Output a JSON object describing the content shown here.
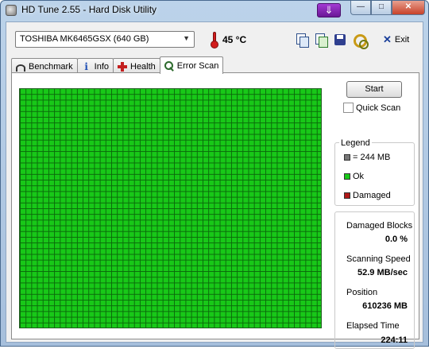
{
  "window": {
    "title": "HD Tune 2.55 - Hard Disk Utility",
    "download_badge": "⇓",
    "controls": {
      "minimize": "—",
      "maximize": "□",
      "close": "✕"
    }
  },
  "toolbar": {
    "drive": "TOSHIBA MK6465GSX (640 GB)",
    "temperature": "45 °C",
    "icons": [
      "copy-text-icon",
      "copy-screenshot-icon",
      "save-icon",
      "options-icon"
    ],
    "exit_label": "Exit"
  },
  "tabs": [
    {
      "label": "Benchmark",
      "icon": "benchmark-icon",
      "active": false
    },
    {
      "label": "Info",
      "icon": "info-icon",
      "active": false
    },
    {
      "label": "Health",
      "icon": "health-icon",
      "active": false
    },
    {
      "label": "Error Scan",
      "icon": "search-icon",
      "active": true
    }
  ],
  "scan": {
    "start_label": "Start",
    "quick_scan_label": "Quick Scan",
    "quick_scan_checked": false,
    "grid_status": "all blocks ok",
    "grid_color": "#18c818"
  },
  "legend": {
    "title": "Legend",
    "items": [
      {
        "label": "= 244 MB",
        "color": "#777777"
      },
      {
        "label": "Ok",
        "color": "#18c818"
      },
      {
        "label": "Damaged",
        "color": "#b01818"
      }
    ]
  },
  "stats": {
    "damaged_blocks_label": "Damaged Blocks",
    "damaged_blocks": "0.0 %",
    "speed_label": "Scanning Speed",
    "speed": "52.9 MB/sec",
    "position_label": "Position",
    "position": "610236 MB",
    "elapsed_label": "Elapsed Time",
    "elapsed": "224:11"
  }
}
